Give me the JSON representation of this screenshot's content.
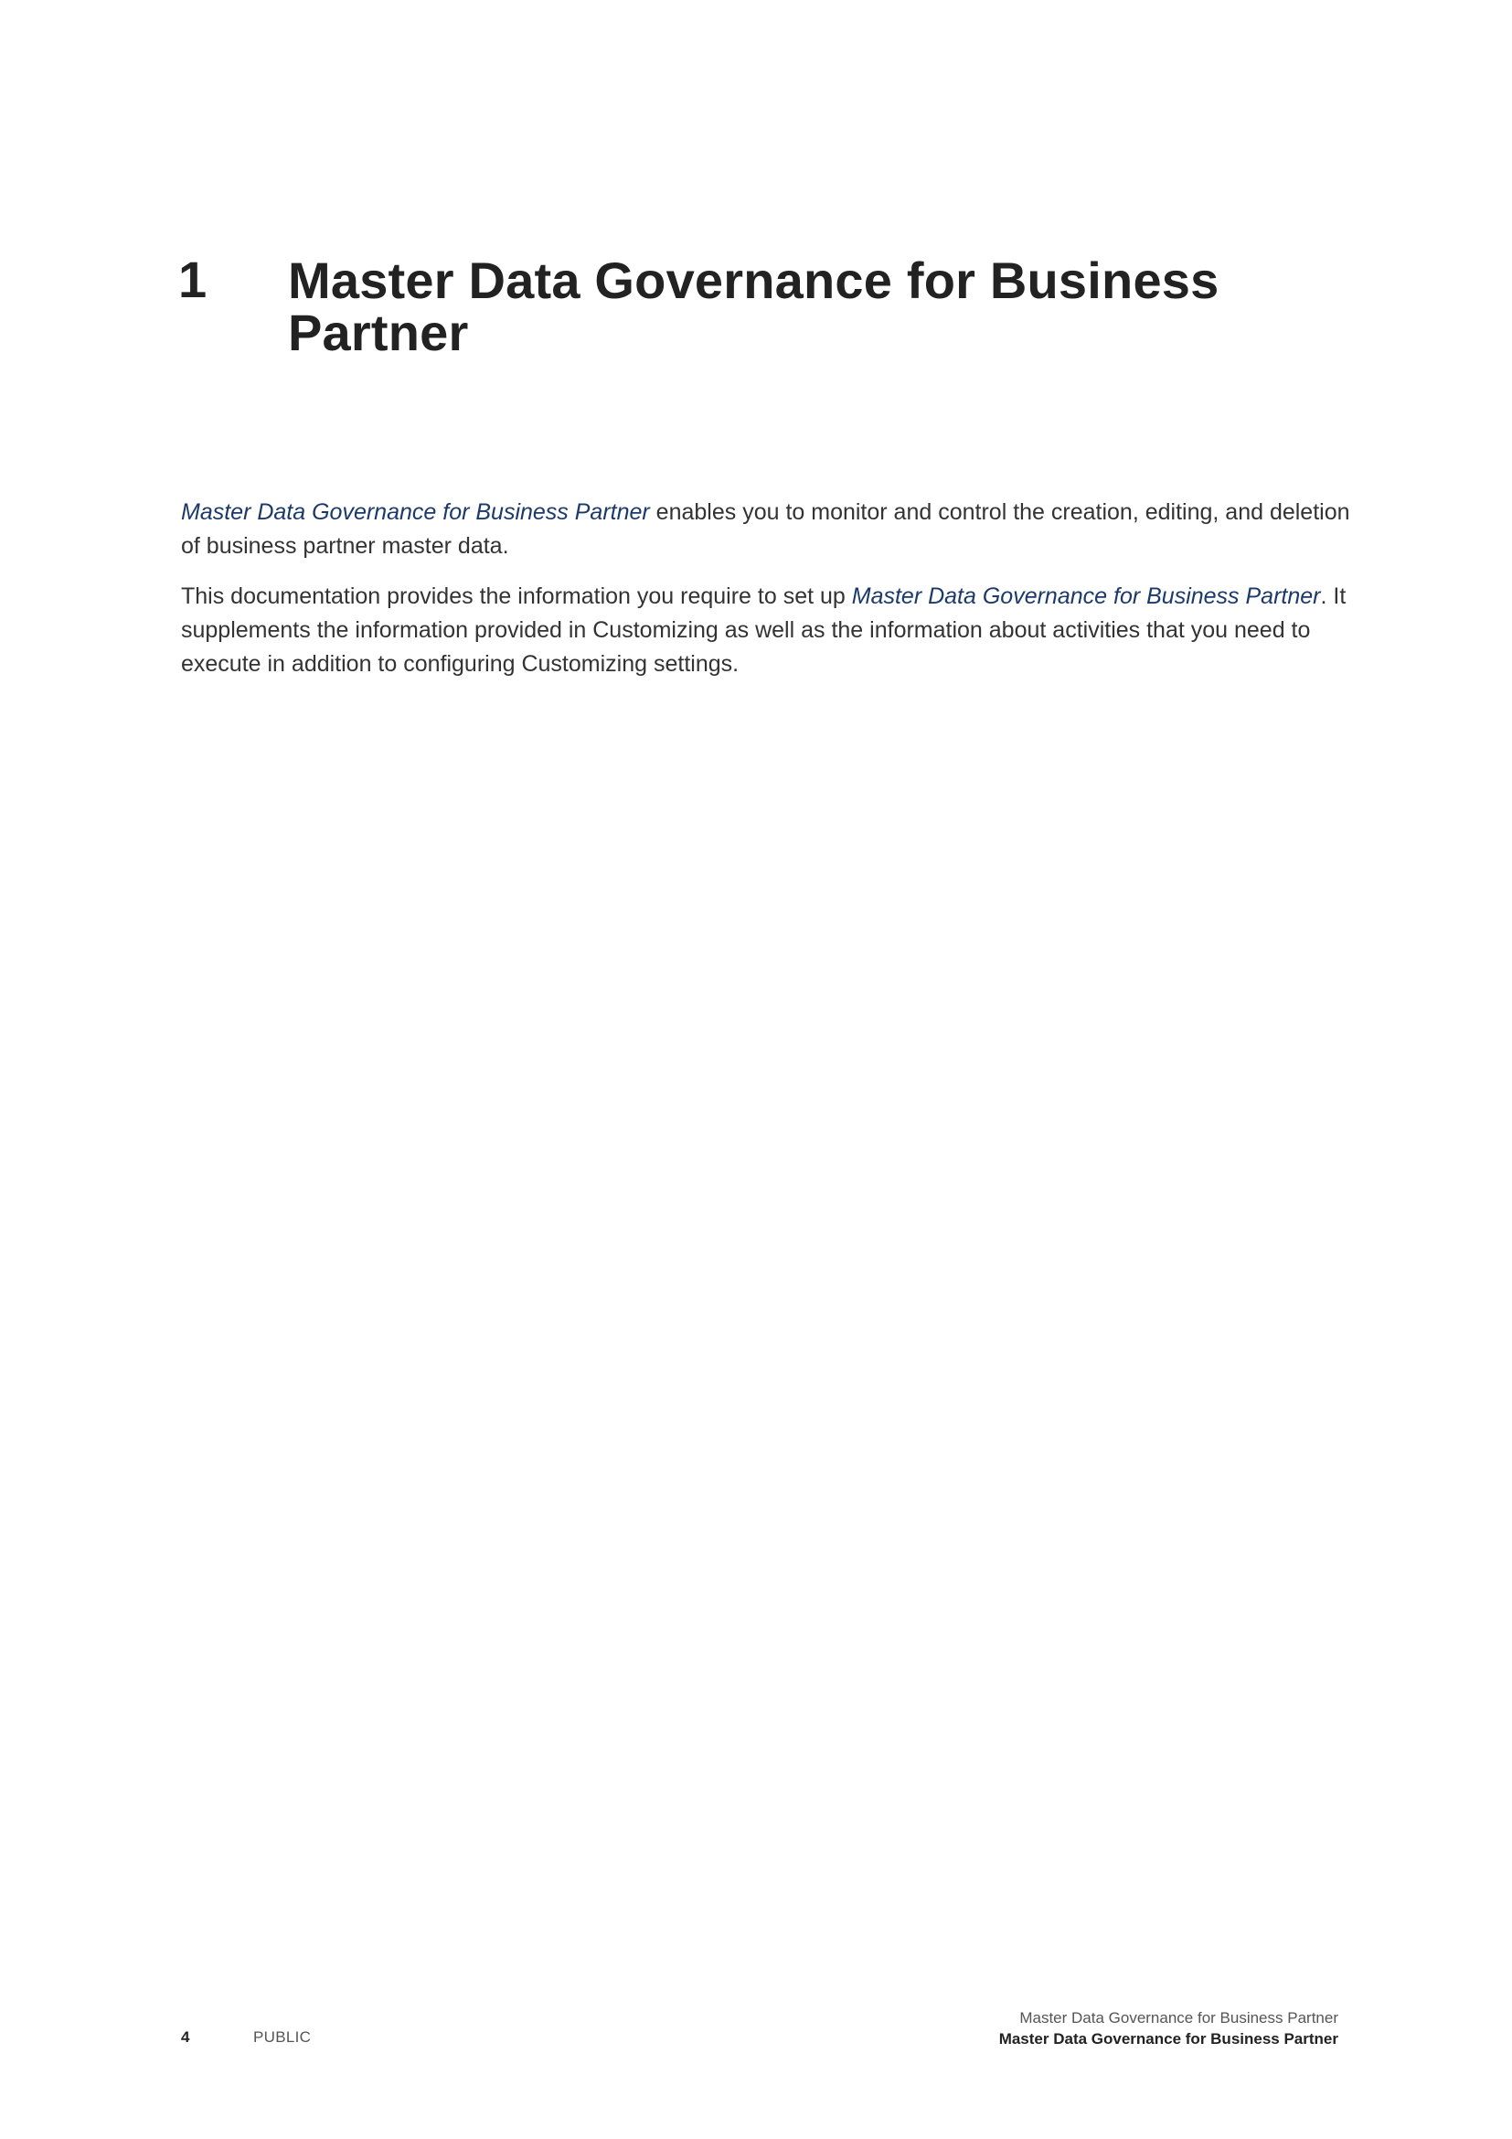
{
  "chapter": {
    "number": "1",
    "title_line1": "Master Data Governance for Business",
    "title_line2": "Partner"
  },
  "paragraphs": [
    {
      "emphasis": "Master Data Governance for Business Partner",
      "text": " enables you to monitor and control the creation, editing, and deletion of business partner master data."
    },
    {
      "text_before": "This documentation provides the information you require to set up ",
      "emphasis": "Master Data Governance for Business Partner",
      "text_after": ". It supplements the information provided in Customizing as well as the information about activities that you need to execute in addition to configuring Customizing settings."
    }
  ],
  "footer": {
    "page_number": "4",
    "classification": "PUBLIC",
    "document_title": "Master Data Governance for Business Partner",
    "section_title": "Master Data Governance for Business Partner"
  },
  "colors": {
    "text": "#222222",
    "emphasis": "#1b3a6b"
  }
}
